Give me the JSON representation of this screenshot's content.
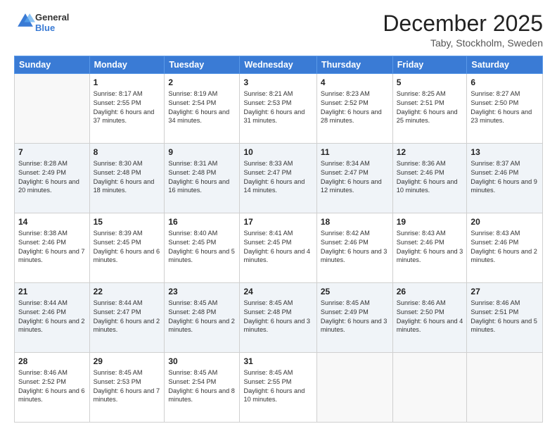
{
  "logo": {
    "text_general": "General",
    "text_blue": "Blue"
  },
  "title": "December 2025",
  "location": "Taby, Stockholm, Sweden",
  "weekdays": [
    "Sunday",
    "Monday",
    "Tuesday",
    "Wednesday",
    "Thursday",
    "Friday",
    "Saturday"
  ],
  "weeks": [
    [
      {
        "day": "",
        "sunrise": "",
        "sunset": "",
        "daylight": ""
      },
      {
        "day": "1",
        "sunrise": "Sunrise: 8:17 AM",
        "sunset": "Sunset: 2:55 PM",
        "daylight": "Daylight: 6 hours and 37 minutes."
      },
      {
        "day": "2",
        "sunrise": "Sunrise: 8:19 AM",
        "sunset": "Sunset: 2:54 PM",
        "daylight": "Daylight: 6 hours and 34 minutes."
      },
      {
        "day": "3",
        "sunrise": "Sunrise: 8:21 AM",
        "sunset": "Sunset: 2:53 PM",
        "daylight": "Daylight: 6 hours and 31 minutes."
      },
      {
        "day": "4",
        "sunrise": "Sunrise: 8:23 AM",
        "sunset": "Sunset: 2:52 PM",
        "daylight": "Daylight: 6 hours and 28 minutes."
      },
      {
        "day": "5",
        "sunrise": "Sunrise: 8:25 AM",
        "sunset": "Sunset: 2:51 PM",
        "daylight": "Daylight: 6 hours and 25 minutes."
      },
      {
        "day": "6",
        "sunrise": "Sunrise: 8:27 AM",
        "sunset": "Sunset: 2:50 PM",
        "daylight": "Daylight: 6 hours and 23 minutes."
      }
    ],
    [
      {
        "day": "7",
        "sunrise": "Sunrise: 8:28 AM",
        "sunset": "Sunset: 2:49 PM",
        "daylight": "Daylight: 6 hours and 20 minutes."
      },
      {
        "day": "8",
        "sunrise": "Sunrise: 8:30 AM",
        "sunset": "Sunset: 2:48 PM",
        "daylight": "Daylight: 6 hours and 18 minutes."
      },
      {
        "day": "9",
        "sunrise": "Sunrise: 8:31 AM",
        "sunset": "Sunset: 2:48 PM",
        "daylight": "Daylight: 6 hours and 16 minutes."
      },
      {
        "day": "10",
        "sunrise": "Sunrise: 8:33 AM",
        "sunset": "Sunset: 2:47 PM",
        "daylight": "Daylight: 6 hours and 14 minutes."
      },
      {
        "day": "11",
        "sunrise": "Sunrise: 8:34 AM",
        "sunset": "Sunset: 2:47 PM",
        "daylight": "Daylight: 6 hours and 12 minutes."
      },
      {
        "day": "12",
        "sunrise": "Sunrise: 8:36 AM",
        "sunset": "Sunset: 2:46 PM",
        "daylight": "Daylight: 6 hours and 10 minutes."
      },
      {
        "day": "13",
        "sunrise": "Sunrise: 8:37 AM",
        "sunset": "Sunset: 2:46 PM",
        "daylight": "Daylight: 6 hours and 9 minutes."
      }
    ],
    [
      {
        "day": "14",
        "sunrise": "Sunrise: 8:38 AM",
        "sunset": "Sunset: 2:46 PM",
        "daylight": "Daylight: 6 hours and 7 minutes."
      },
      {
        "day": "15",
        "sunrise": "Sunrise: 8:39 AM",
        "sunset": "Sunset: 2:45 PM",
        "daylight": "Daylight: 6 hours and 6 minutes."
      },
      {
        "day": "16",
        "sunrise": "Sunrise: 8:40 AM",
        "sunset": "Sunset: 2:45 PM",
        "daylight": "Daylight: 6 hours and 5 minutes."
      },
      {
        "day": "17",
        "sunrise": "Sunrise: 8:41 AM",
        "sunset": "Sunset: 2:45 PM",
        "daylight": "Daylight: 6 hours and 4 minutes."
      },
      {
        "day": "18",
        "sunrise": "Sunrise: 8:42 AM",
        "sunset": "Sunset: 2:46 PM",
        "daylight": "Daylight: 6 hours and 3 minutes."
      },
      {
        "day": "19",
        "sunrise": "Sunrise: 8:43 AM",
        "sunset": "Sunset: 2:46 PM",
        "daylight": "Daylight: 6 hours and 3 minutes."
      },
      {
        "day": "20",
        "sunrise": "Sunrise: 8:43 AM",
        "sunset": "Sunset: 2:46 PM",
        "daylight": "Daylight: 6 hours and 2 minutes."
      }
    ],
    [
      {
        "day": "21",
        "sunrise": "Sunrise: 8:44 AM",
        "sunset": "Sunset: 2:46 PM",
        "daylight": "Daylight: 6 hours and 2 minutes."
      },
      {
        "day": "22",
        "sunrise": "Sunrise: 8:44 AM",
        "sunset": "Sunset: 2:47 PM",
        "daylight": "Daylight: 6 hours and 2 minutes."
      },
      {
        "day": "23",
        "sunrise": "Sunrise: 8:45 AM",
        "sunset": "Sunset: 2:48 PM",
        "daylight": "Daylight: 6 hours and 2 minutes."
      },
      {
        "day": "24",
        "sunrise": "Sunrise: 8:45 AM",
        "sunset": "Sunset: 2:48 PM",
        "daylight": "Daylight: 6 hours and 3 minutes."
      },
      {
        "day": "25",
        "sunrise": "Sunrise: 8:45 AM",
        "sunset": "Sunset: 2:49 PM",
        "daylight": "Daylight: 6 hours and 3 minutes."
      },
      {
        "day": "26",
        "sunrise": "Sunrise: 8:46 AM",
        "sunset": "Sunset: 2:50 PM",
        "daylight": "Daylight: 6 hours and 4 minutes."
      },
      {
        "day": "27",
        "sunrise": "Sunrise: 8:46 AM",
        "sunset": "Sunset: 2:51 PM",
        "daylight": "Daylight: 6 hours and 5 minutes."
      }
    ],
    [
      {
        "day": "28",
        "sunrise": "Sunrise: 8:46 AM",
        "sunset": "Sunset: 2:52 PM",
        "daylight": "Daylight: 6 hours and 6 minutes."
      },
      {
        "day": "29",
        "sunrise": "Sunrise: 8:45 AM",
        "sunset": "Sunset: 2:53 PM",
        "daylight": "Daylight: 6 hours and 7 minutes."
      },
      {
        "day": "30",
        "sunrise": "Sunrise: 8:45 AM",
        "sunset": "Sunset: 2:54 PM",
        "daylight": "Daylight: 6 hours and 8 minutes."
      },
      {
        "day": "31",
        "sunrise": "Sunrise: 8:45 AM",
        "sunset": "Sunset: 2:55 PM",
        "daylight": "Daylight: 6 hours and 10 minutes."
      },
      {
        "day": "",
        "sunrise": "",
        "sunset": "",
        "daylight": ""
      },
      {
        "day": "",
        "sunrise": "",
        "sunset": "",
        "daylight": ""
      },
      {
        "day": "",
        "sunrise": "",
        "sunset": "",
        "daylight": ""
      }
    ]
  ]
}
